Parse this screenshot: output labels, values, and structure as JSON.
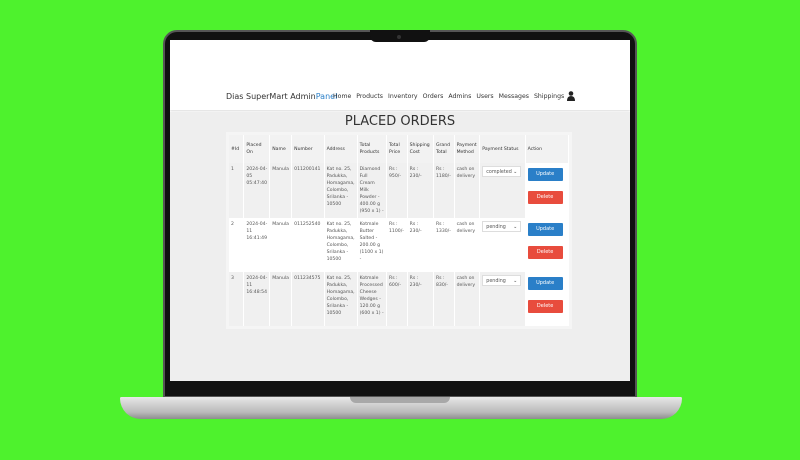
{
  "brand": {
    "main": "Dias SuperMart Admin",
    "accent": "Panel"
  },
  "nav": [
    "Home",
    "Products",
    "Inventory",
    "Orders",
    "Admins",
    "Users",
    "Messages",
    "Shippings"
  ],
  "page_title": "PLACED ORDERS",
  "columns": [
    "#Id",
    "Placed On",
    "Name",
    "Number",
    "Address",
    "Total Products",
    "Total Price",
    "Shipping Cost",
    "Grand Total",
    "Payment Method",
    "Payment Status",
    "Action"
  ],
  "orders": [
    {
      "id": "1",
      "placed": "2024-04-05 05:47:40",
      "name": "Manula",
      "number": "011200141",
      "address": "Kat no. 25, Padukka, Homagama, Colombo, Srilanka - 10500",
      "products": "Diamond Full Cream Milk Powder - 400.00 g (950 x 1) -",
      "price": "Rs : 950/-",
      "shipping": "Rs : 230/-",
      "grand": "Rs : 1180/-",
      "method": "cash on delivery",
      "status": "completed"
    },
    {
      "id": "2",
      "placed": "2024-04-11 16:41:49",
      "name": "Manula",
      "number": "011252540",
      "address": "Kat no. 25, Padukka, Homagama, Colombo, Srilanka - 10500",
      "products": "Kotmale Butter Salted - 200.00 g (1100 x 1) -",
      "price": "Rs : 1100/-",
      "shipping": "Rs : 230/-",
      "grand": "Rs : 1330/-",
      "method": "cash on delivery",
      "status": "pending"
    },
    {
      "id": "3",
      "placed": "2024-04-11 16:48:54",
      "name": "Manula",
      "number": "011234575",
      "address": "Kat no. 25, Padukka, Homagama, Colombo, Srilanka - 10500",
      "products": "Kotmale Processed Cheese Wedges - 120.00 g (600 x 1) -",
      "price": "Rs : 600/-",
      "shipping": "Rs : 230/-",
      "grand": "Rs : 830/-",
      "method": "cash on delivery",
      "status": "pending"
    }
  ],
  "buttons": {
    "update": "Update",
    "delete": "Delete"
  },
  "colors": {
    "background": "#4ef22d",
    "accent": "#2a7fc8",
    "danger": "#e84c3d"
  }
}
